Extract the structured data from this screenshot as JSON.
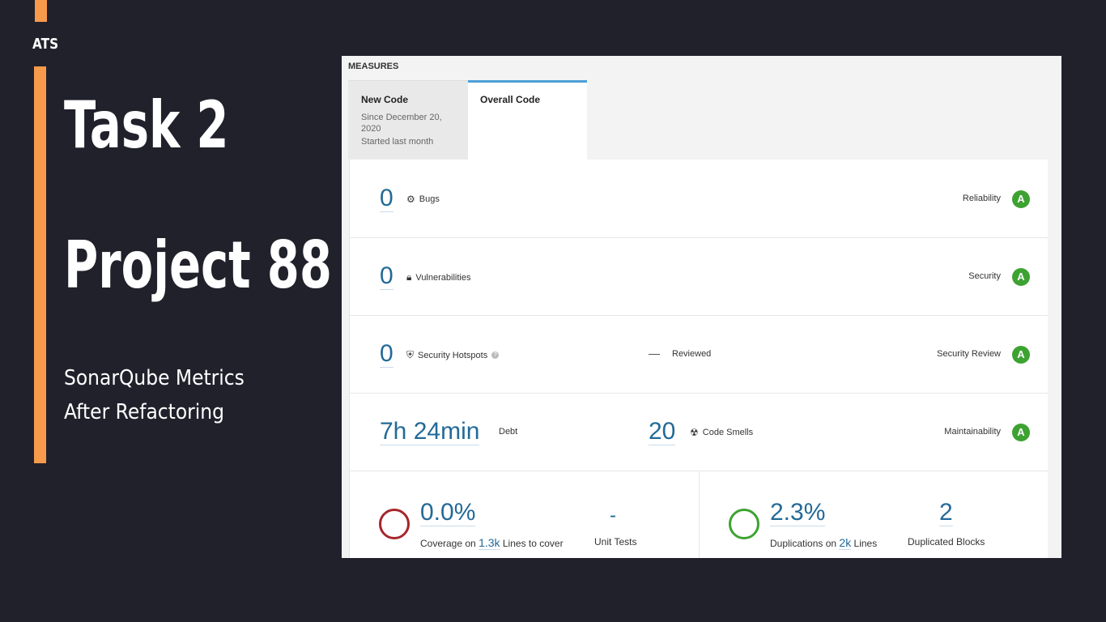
{
  "slide": {
    "brand": "ATS",
    "title": "Task 2",
    "project": "Project 88",
    "subtitle_line1": "SonarQube Metrics",
    "subtitle_line2": "After Refactoring"
  },
  "sonar": {
    "header": "MEASURES",
    "tabs": {
      "new_code": {
        "title": "New Code",
        "since": "Since December 20, 2020",
        "started": "Started last month"
      },
      "overall": {
        "title": "Overall Code"
      }
    },
    "bugs": {
      "value": "0",
      "label": "Bugs",
      "quality_label": "Reliability",
      "grade": "A"
    },
    "vulnerabilities": {
      "value": "0",
      "label": "Vulnerabilities",
      "quality_label": "Security",
      "grade": "A"
    },
    "hotspots": {
      "value": "0",
      "label": "Security Hotspots",
      "reviewed_label": "Reviewed",
      "quality_label": "Security Review",
      "grade": "A"
    },
    "maintainability": {
      "debt_value": "7h 24min",
      "debt_label": "Debt",
      "smells_value": "20",
      "smells_label": "Code Smells",
      "quality_label": "Maintainability",
      "grade": "A"
    },
    "coverage": {
      "value": "0.0%",
      "label_prefix": "Coverage on",
      "lines_value": "1.3k",
      "label_suffix": "Lines to cover",
      "unit_tests_value": "-",
      "unit_tests_label": "Unit Tests",
      "ring_color": "#a4262c"
    },
    "duplications": {
      "value": "2.3%",
      "label_prefix": "Duplications on",
      "lines_value": "2k",
      "label_suffix": "Lines",
      "blocks_value": "2",
      "blocks_label": "Duplicated Blocks",
      "ring_color": "#3da231"
    }
  }
}
